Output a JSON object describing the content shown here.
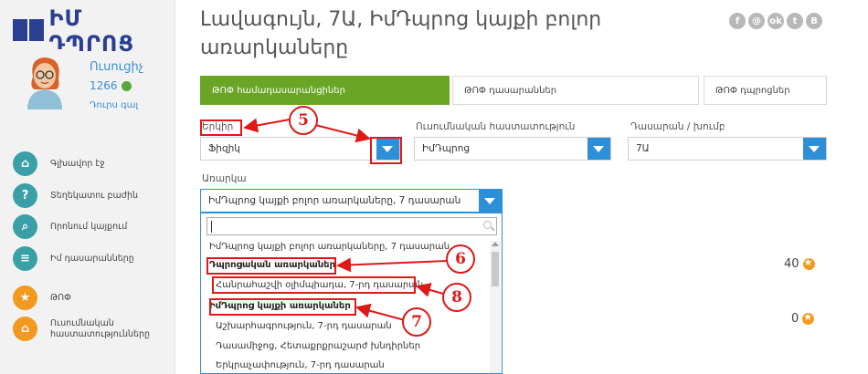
{
  "sidebar": {
    "logo_text": "ԻՄ ԴՊՐՈՑ",
    "user": {
      "name": "Ուսուցիչ",
      "points": "1266",
      "logout": "Դուրս գալ"
    },
    "items": [
      {
        "label": "Գլխավոր էջ",
        "icon": "home-icon"
      },
      {
        "label": "Տեղեկատու բաժին",
        "icon": "question-icon"
      },
      {
        "label": "Որոնում կայքում",
        "icon": "search-icon"
      },
      {
        "label": "Իմ դասարանները",
        "icon": "class-icon"
      },
      {
        "label": "ԹՈՓ",
        "icon": "star-icon"
      },
      {
        "label": "Ուսումնական հաստատությունները",
        "icon": "institution-icon"
      }
    ]
  },
  "header": {
    "title": "Լավագույն, 7Ա, ԻմԴպրոց կայքի բոլոր առարկաները",
    "socials": [
      "f",
      "@",
      "ok",
      "t",
      "B"
    ]
  },
  "tabs": [
    "ԹՈՓ համադասարանցիներ",
    "ԹՈՓ դասարաններ",
    "ԹՈՓ դպրոցներ"
  ],
  "filters": {
    "country": {
      "label": "Երկիր",
      "value": "Ֆիզիկ"
    },
    "institution": {
      "label": "Ուսումնական հաստատություն",
      "value": "ԻմԴպրոց"
    },
    "class": {
      "label": "Դասարան / խումբ",
      "value": "7Ա"
    },
    "subject": {
      "label": "Առարկա",
      "value": "ԻմԴպրոց կայքի բոլոր առարկաները, 7 դասարան"
    }
  },
  "dropdown": {
    "search_value": "",
    "items": [
      {
        "label": "ԻմԴպրոց կայքի բոլոր առարկաները, 7 դասարան",
        "group": false
      },
      {
        "label": "Դպրոցական առարկաներ",
        "group": true
      },
      {
        "label": "Հանրահաշվի օլիմպիադա, 7-րդ դասարան",
        "group": false
      },
      {
        "label": "ԻմԴպրոց կայքի առարկաներ",
        "group": true
      },
      {
        "label": "Աշխարհագրություն, 7-րդ դասարան",
        "group": false
      },
      {
        "label": "Դասամիջոց, Հետաքրքրաշարժ խնդիրներ",
        "group": false
      },
      {
        "label": "Երկրաչափություն, 7-րդ դասարան",
        "group": false
      }
    ]
  },
  "scores": [
    "40",
    "0"
  ],
  "callouts": [
    "5",
    "6",
    "7",
    "8"
  ],
  "colors": {
    "accent": "#2d8fd8",
    "active_tab": "#6aa526",
    "annotation": "#e01818",
    "logo": "#2a3f8f"
  }
}
